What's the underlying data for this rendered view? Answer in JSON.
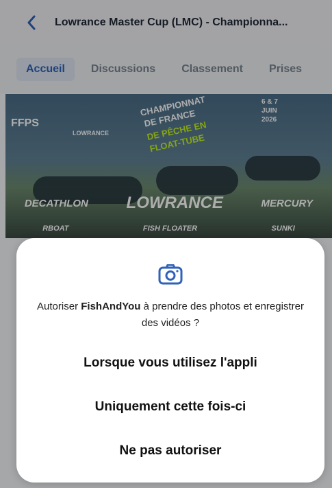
{
  "header": {
    "title": "Lowrance Master Cup (LMC) - Championna..."
  },
  "tabs": [
    {
      "label": "Accueil"
    },
    {
      "label": "Discussions"
    },
    {
      "label": "Classement"
    },
    {
      "label": "Prises"
    }
  ],
  "banner": {
    "left_logo": "FFPS",
    "center_logo": "LOWRANCE",
    "headline_1": "CHAMPIONNAT",
    "headline_2": "DE FRANCE",
    "headline_3": "DE PÊCHE EN",
    "headline_4": "FLOAT-TUBE",
    "date_1": "6 & 7",
    "date_2": "JUIN",
    "date_3": "2026",
    "sponsors": [
      "DECATHLON",
      "LOWRANCE",
      "MERCURY"
    ],
    "sponsors_2": [
      "RBOAT",
      "FISH FLOATER",
      "SUNKI"
    ]
  },
  "dialog": {
    "icon": "camera-icon",
    "message_prefix": "Autoriser ",
    "app_name": "FishAndYou",
    "message_suffix": " à prendre des photos et enregistrer des vidéos ?",
    "options": [
      {
        "label": "Lorsque vous utilisez l'appli"
      },
      {
        "label": "Uniquement cette fois-ci"
      },
      {
        "label": "Ne pas autoriser"
      }
    ]
  },
  "colors": {
    "accent": "#2f62b8",
    "scrim": "rgba(0,0,0,0.32)"
  }
}
